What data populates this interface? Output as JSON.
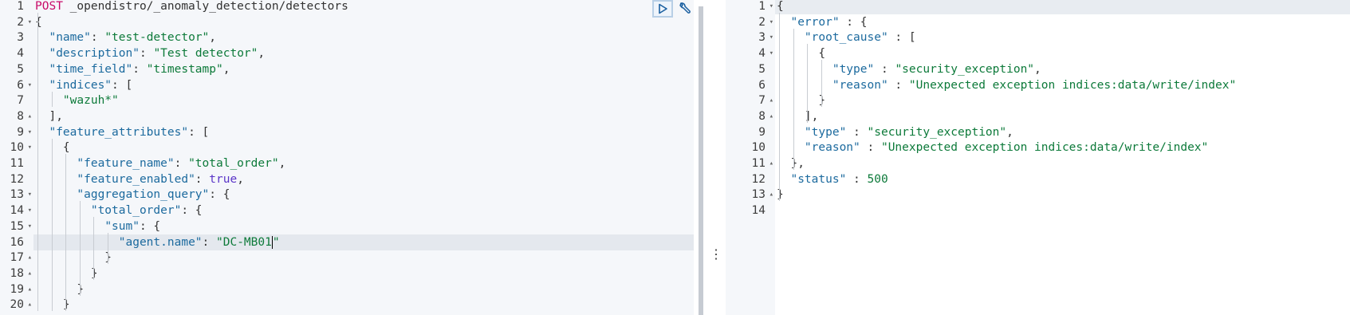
{
  "request_editor": {
    "lines": [
      [
        [
          "method",
          "POST"
        ],
        [
          "url",
          " _opendistro/_anomaly_detection/detectors"
        ]
      ],
      [
        [
          "p",
          "{"
        ]
      ],
      [
        [
          "p",
          "  "
        ],
        [
          "key",
          "\"name\""
        ],
        [
          "p",
          ": "
        ],
        [
          "str",
          "\"test-detector\""
        ],
        [
          "p",
          ","
        ]
      ],
      [
        [
          "p",
          "  "
        ],
        [
          "key",
          "\"description\""
        ],
        [
          "p",
          ": "
        ],
        [
          "str",
          "\"Test detector\""
        ],
        [
          "p",
          ","
        ]
      ],
      [
        [
          "p",
          "  "
        ],
        [
          "key",
          "\"time_field\""
        ],
        [
          "p",
          ": "
        ],
        [
          "str",
          "\"timestamp\""
        ],
        [
          "p",
          ","
        ]
      ],
      [
        [
          "p",
          "  "
        ],
        [
          "key",
          "\"indices\""
        ],
        [
          "p",
          ": ["
        ]
      ],
      [
        [
          "p",
          "    "
        ],
        [
          "str",
          "\"wazuh*\""
        ]
      ],
      [
        [
          "p",
          "  ],"
        ]
      ],
      [
        [
          "p",
          "  "
        ],
        [
          "key",
          "\"feature_attributes\""
        ],
        [
          "p",
          ": ["
        ]
      ],
      [
        [
          "p",
          "    {"
        ]
      ],
      [
        [
          "p",
          "      "
        ],
        [
          "key",
          "\"feature_name\""
        ],
        [
          "p",
          ": "
        ],
        [
          "str",
          "\"total_order\""
        ],
        [
          "p",
          ","
        ]
      ],
      [
        [
          "p",
          "      "
        ],
        [
          "key",
          "\"feature_enabled\""
        ],
        [
          "p",
          ": "
        ],
        [
          "bool",
          "true"
        ],
        [
          "p",
          ","
        ]
      ],
      [
        [
          "p",
          "      "
        ],
        [
          "key",
          "\"aggregation_query\""
        ],
        [
          "p",
          ": {"
        ]
      ],
      [
        [
          "p",
          "        "
        ],
        [
          "key",
          "\"total_order\""
        ],
        [
          "p",
          ": {"
        ]
      ],
      [
        [
          "p",
          "          "
        ],
        [
          "key",
          "\"sum\""
        ],
        [
          "p",
          ": {"
        ]
      ],
      [
        [
          "p",
          "            "
        ],
        [
          "key",
          "\"agent.name\""
        ],
        [
          "p",
          ": "
        ],
        [
          "str",
          "\"DC-MB01\""
        ]
      ],
      [
        [
          "p",
          "          }"
        ]
      ],
      [
        [
          "p",
          "        }"
        ]
      ],
      [
        [
          "p",
          "      }"
        ]
      ],
      [
        [
          "p",
          "    }"
        ]
      ]
    ],
    "line_numbers": [
      "1",
      "2",
      "3",
      "4",
      "5",
      "6",
      "7",
      "8",
      "9",
      "10",
      "11",
      "12",
      "13",
      "14",
      "15",
      "16",
      "17",
      "18",
      "19",
      "20"
    ],
    "fold_markers": [
      "",
      "▾",
      "",
      "",
      "",
      "▾",
      "",
      "▴",
      "▾",
      "▾",
      "",
      "",
      "▾",
      "▾",
      "▾",
      "",
      "▴",
      "▴",
      "▴",
      "▴"
    ],
    "active_line": 16
  },
  "response_viewer": {
    "lines": [
      [
        [
          "p",
          "{"
        ]
      ],
      [
        [
          "p",
          "  "
        ],
        [
          "key",
          "\"error\""
        ],
        [
          "p",
          " : {"
        ]
      ],
      [
        [
          "p",
          "    "
        ],
        [
          "key",
          "\"root_cause\""
        ],
        [
          "p",
          " : ["
        ]
      ],
      [
        [
          "p",
          "      {"
        ]
      ],
      [
        [
          "p",
          "        "
        ],
        [
          "key",
          "\"type\""
        ],
        [
          "p",
          " : "
        ],
        [
          "str",
          "\"security_exception\""
        ],
        [
          "p",
          ","
        ]
      ],
      [
        [
          "p",
          "        "
        ],
        [
          "key",
          "\"reason\""
        ],
        [
          "p",
          " : "
        ],
        [
          "str",
          "\"Unexpected exception indices:data/write/index\""
        ]
      ],
      [
        [
          "p",
          "      }"
        ]
      ],
      [
        [
          "p",
          "    ],"
        ]
      ],
      [
        [
          "p",
          "    "
        ],
        [
          "key",
          "\"type\""
        ],
        [
          "p",
          " : "
        ],
        [
          "str",
          "\"security_exception\""
        ],
        [
          "p",
          ","
        ]
      ],
      [
        [
          "p",
          "    "
        ],
        [
          "key",
          "\"reason\""
        ],
        [
          "p",
          " : "
        ],
        [
          "str",
          "\"Unexpected exception indices:data/write/index\""
        ]
      ],
      [
        [
          "p",
          "  },"
        ]
      ],
      [
        [
          "p",
          "  "
        ],
        [
          "key",
          "\"status\""
        ],
        [
          "p",
          " : "
        ],
        [
          "num",
          "500"
        ]
      ],
      [
        [
          "p",
          "}"
        ]
      ],
      [
        [
          "p",
          ""
        ]
      ]
    ],
    "line_numbers": [
      "1",
      "2",
      "3",
      "4",
      "5",
      "6",
      "7",
      "8",
      "9",
      "10",
      "11",
      "12",
      "13",
      "14"
    ],
    "fold_markers": [
      "▾",
      "▾",
      "▾",
      "▾",
      "",
      "",
      "▴",
      "▴",
      "",
      "",
      "▴",
      "",
      "▴",
      ""
    ],
    "active_line": 1
  },
  "toolbar": {
    "run_icon": "play-icon",
    "settings_icon": "wrench-icon"
  },
  "splitter": {
    "handle_glyph": "⋮"
  },
  "colors": {
    "method": "#c80a68",
    "key": "#1c6a9e",
    "string": "#0d7a3a",
    "boolean": "#5a35c8"
  }
}
